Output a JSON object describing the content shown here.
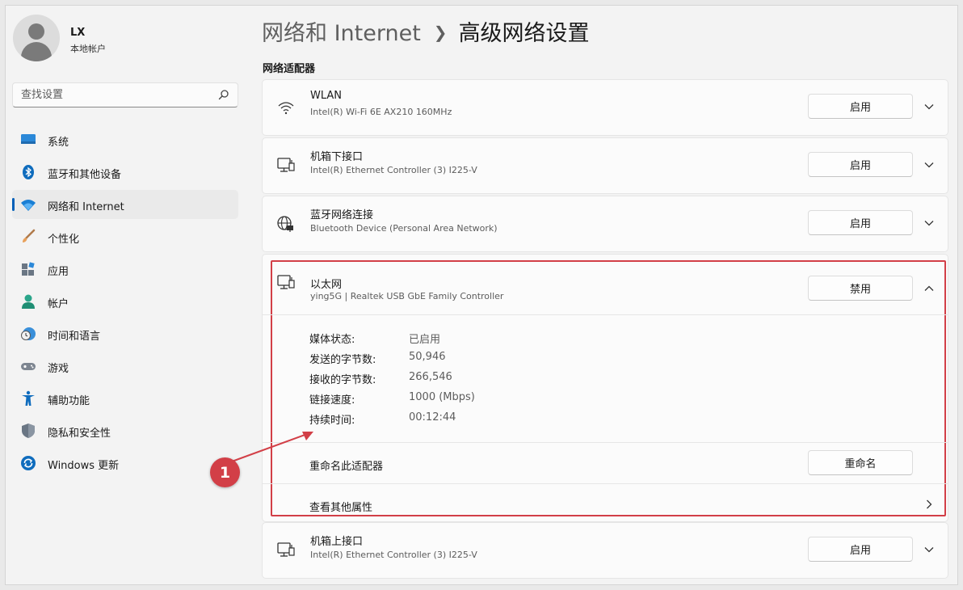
{
  "user": {
    "name": "LX",
    "account_type": "本地帐户"
  },
  "search": {
    "placeholder": "查找设置"
  },
  "nav": [
    {
      "label": "系统",
      "icon": "monitor-icon",
      "active": false
    },
    {
      "label": "蓝牙和其他设备",
      "icon": "bluetooth-icon",
      "active": false
    },
    {
      "label": "网络和 Internet",
      "icon": "wifi-icon",
      "active": true
    },
    {
      "label": "个性化",
      "icon": "brush-icon",
      "active": false
    },
    {
      "label": "应用",
      "icon": "apps-icon",
      "active": false
    },
    {
      "label": "帐户",
      "icon": "person-icon",
      "active": false
    },
    {
      "label": "时间和语言",
      "icon": "clock-globe-icon",
      "active": false
    },
    {
      "label": "游戏",
      "icon": "gamepad-icon",
      "active": false
    },
    {
      "label": "辅助功能",
      "icon": "accessibility-icon",
      "active": false
    },
    {
      "label": "隐私和安全性",
      "icon": "shield-icon",
      "active": false
    },
    {
      "label": "Windows 更新",
      "icon": "update-icon",
      "active": false
    }
  ],
  "breadcrumb": {
    "parent": "网络和 Internet",
    "current": "高级网络设置"
  },
  "section_title": "网络适配器",
  "adapters": [
    {
      "name": "WLAN",
      "desc": "Intel(R) Wi-Fi 6E AX210 160MHz",
      "button": "启用",
      "icon": "wifi-icon"
    },
    {
      "name": "机箱下接口",
      "desc": "Intel(R) Ethernet Controller (3) I225-V",
      "button": "启用",
      "icon": "ethernet-icon"
    },
    {
      "name": "蓝牙网络连接",
      "desc": "Bluetooth Device (Personal Area Network)",
      "button": "启用",
      "icon": "globe-network-icon"
    }
  ],
  "expanded": {
    "name": "以太网",
    "desc": "ying5G | Realtek USB GbE Family Controller",
    "button": "禁用",
    "icon": "ethernet-icon",
    "details": [
      {
        "label": "媒体状态:",
        "value": "已启用"
      },
      {
        "label": "发送的字节数:",
        "value": "50,946"
      },
      {
        "label": "接收的字节数:",
        "value": "266,546"
      },
      {
        "label": "链接速度:",
        "value": "1000 (Mbps)"
      },
      {
        "label": "持续时间:",
        "value": "00:12:44"
      }
    ],
    "rename_label": "重命名此适配器",
    "rename_button": "重命名",
    "more_props_label": "查看其他属性"
  },
  "last_adapter": {
    "name": "机箱上接口",
    "desc": "Intel(R) Ethernet Controller (3) I225-V",
    "button": "启用",
    "icon": "ethernet-icon"
  },
  "annotation": {
    "number": "1",
    "color": "#d23f47"
  },
  "colors": {
    "accent": "#005fb8",
    "highlight": "#d23f47"
  }
}
